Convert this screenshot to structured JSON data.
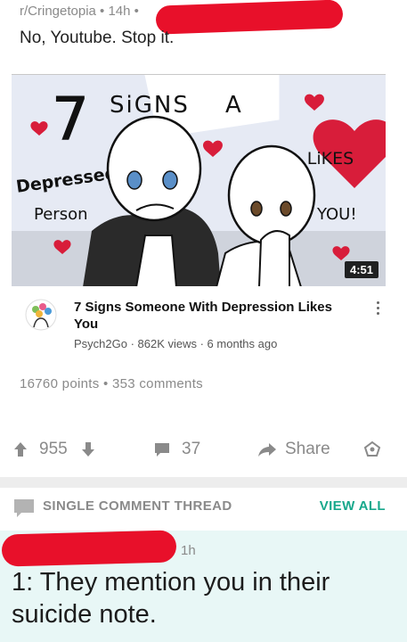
{
  "post": {
    "meta": "r/Cringetopia • 14h •",
    "title": "No, Youtube. Stop it.",
    "stats": "16760 points • 353 comments"
  },
  "video": {
    "thumbnail_text": {
      "number": "7",
      "signs": "SiGNS",
      "a": "A",
      "depressed": "Depressed",
      "person": "Person",
      "likes": "LiKES",
      "you": "YOU!"
    },
    "duration": "4:51",
    "title": "7 Signs Someone With Depression Likes You",
    "subline": "Psych2Go · 862K views · 6 months ago",
    "colors": {
      "heart": "#d81d3a",
      "badge_bg": "#000000"
    }
  },
  "actions": {
    "upvote_icon": "arrow-up-icon",
    "score": "955",
    "downvote_icon": "arrow-down-icon",
    "comment_icon": "comment-icon",
    "comments": "37",
    "share_icon": "share-arrow-icon",
    "share_label": "Share",
    "award_icon": "award-icon"
  },
  "thread": {
    "label": "SINGLE COMMENT THREAD",
    "view_all": "VIEW ALL",
    "accent": "#18a88c"
  },
  "comment": {
    "time": "1h",
    "body": "1: They mention you in their suicide note."
  }
}
